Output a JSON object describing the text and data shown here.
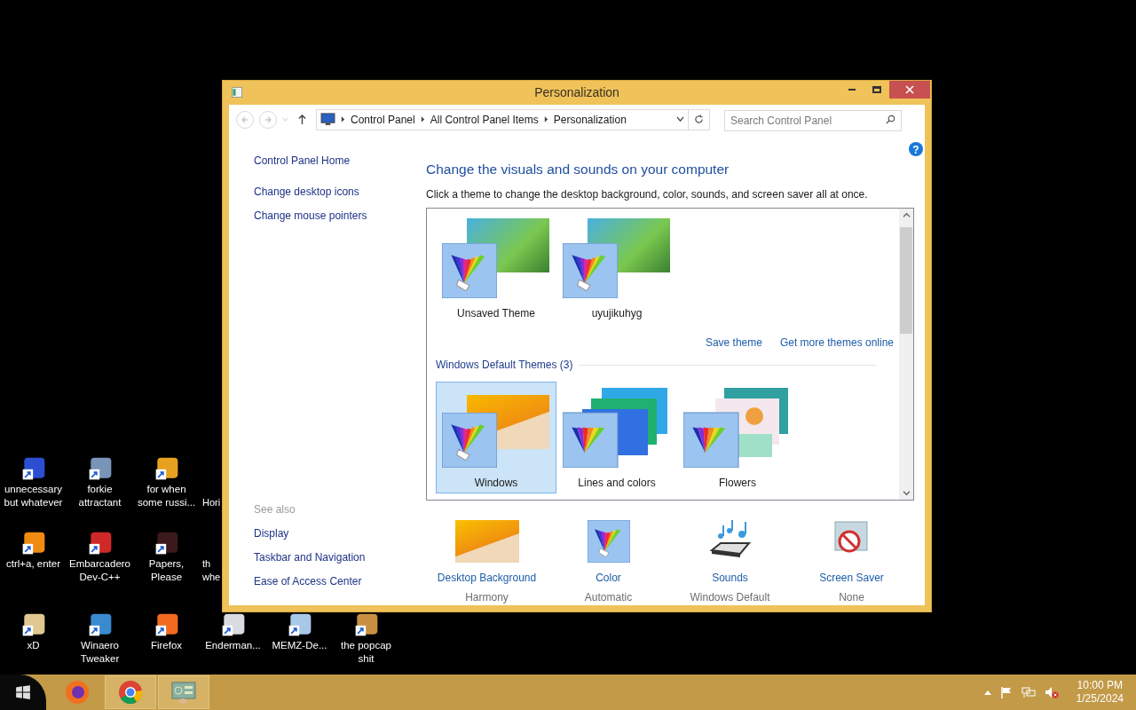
{
  "desktop": {
    "rows": [
      [
        {
          "kind": "shortcut",
          "label": "unnecessary\nbut whatever",
          "color": "#2b4fd0"
        },
        {
          "kind": "shortcut",
          "label": "forkie\nattractant",
          "color": "#7a94b8"
        },
        {
          "kind": "shortcut",
          "label": "for when\nsome russi...",
          "color": "#e8a020"
        },
        {
          "kind": "covered",
          "label": "Hori"
        }
      ],
      [
        {
          "kind": "shortcut",
          "label": "ctrl+a, enter",
          "color": "#f08a10"
        },
        {
          "kind": "shortcut",
          "label": "Embarcadero\nDev-C++",
          "color": "#d02828"
        },
        {
          "kind": "shortcut",
          "label": "Papers,\nPlease",
          "color": "#3a1a1a"
        },
        {
          "kind": "covered",
          "label": "th\nwhe"
        }
      ],
      [
        {
          "kind": "shortcut",
          "label": "xD",
          "color": "#e0c890"
        },
        {
          "kind": "shortcut",
          "label": "Winaero\nTweaker",
          "color": "#3a8ad0"
        },
        {
          "kind": "shortcut",
          "label": "Firefox",
          "color": "#f06a20"
        },
        {
          "kind": "shortcut",
          "label": "Enderman...",
          "color": "#d8dce0"
        },
        {
          "kind": "shortcut",
          "label": "MEMZ-De...",
          "color": "#a8c8e8"
        },
        {
          "kind": "shortcut",
          "label": "the popcap\nshit",
          "color": "#c89040"
        }
      ]
    ]
  },
  "window": {
    "title": "Personalization",
    "nav": {
      "back_disabled": true,
      "forward_disabled": true
    },
    "breadcrumb": [
      "Control Panel",
      "All Control Panel Items",
      "Personalization"
    ],
    "search": {
      "placeholder": "Search Control Panel"
    },
    "help_glyph": "?",
    "sidebar": {
      "items": [
        "Control Panel Home",
        "Change desktop icons",
        "Change mouse pointers"
      ],
      "see_also": {
        "heading": "See also",
        "items": [
          "Display",
          "Taskbar and Navigation",
          "Ease of Access Center"
        ]
      }
    },
    "heading": "Change the visuals and sounds on your computer",
    "description": "Click a theme to change the desktop background, color, sounds, and screen saver all at once.",
    "my_themes": [
      {
        "kind": "custom",
        "name": "Unsaved Theme",
        "selected": false
      },
      {
        "kind": "custom",
        "name": "uyujikuhyg",
        "selected": false
      }
    ],
    "theme_links": [
      "Save theme",
      "Get more themes online"
    ],
    "default_section": {
      "heading": "Windows Default Themes (3)",
      "themes": [
        {
          "kind": "windows",
          "name": "Windows",
          "selected": true
        },
        {
          "kind": "lines",
          "name": "Lines and colors",
          "selected": false
        },
        {
          "kind": "flowers",
          "name": "Flowers",
          "selected": false
        }
      ]
    },
    "settings": [
      {
        "kind": "background",
        "label": "Desktop Background",
        "value": "Harmony"
      },
      {
        "kind": "color",
        "label": "Color",
        "value": "Automatic"
      },
      {
        "kind": "sounds",
        "label": "Sounds",
        "value": "Windows Default"
      },
      {
        "kind": "screensaver",
        "label": "Screen Saver",
        "value": "None"
      }
    ]
  },
  "taskbar": {
    "apps": [
      {
        "kind": "firefox",
        "running": false
      },
      {
        "kind": "chrome",
        "running": true
      },
      {
        "kind": "control-panel",
        "running": true
      }
    ],
    "time": "10:00 PM",
    "date": "1/25/2024"
  }
}
